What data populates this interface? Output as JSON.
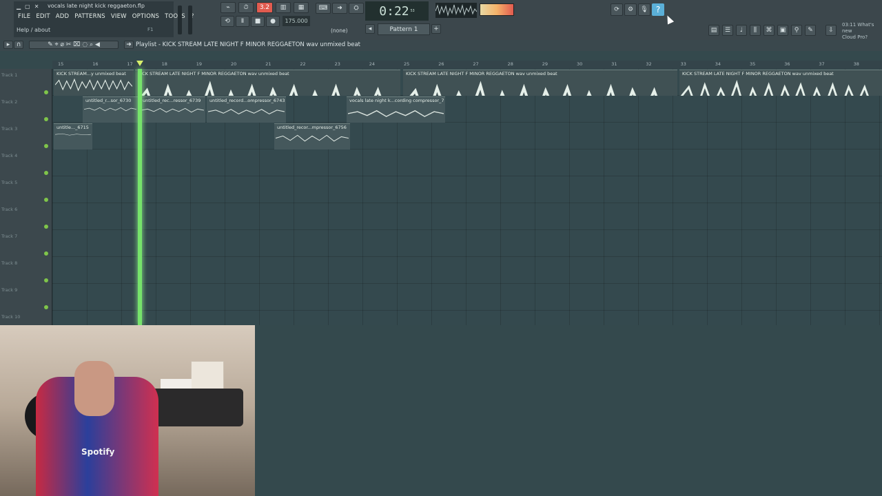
{
  "app": {
    "window_title": "vocals late night kick reggaeton.flp",
    "window_buttons": [
      "▁",
      "▢",
      "✕"
    ],
    "menu": [
      "FILE",
      "EDIT",
      "ADD",
      "PATTERNS",
      "VIEW",
      "OPTIONS",
      "TOOLS",
      "?"
    ],
    "hint_text": "Help / about",
    "hint_shortcut": "F1"
  },
  "transport": {
    "time": "0:22",
    "time_small": "53",
    "time_units": "M:S:CS",
    "tempo": "175.000",
    "step": "3.2",
    "none_label": "(none)",
    "pattern": "Pattern 1"
  },
  "playlist": {
    "title": "Playlist - KICK STREAM LATE NIGHT F MINOR REGGAETON wav unmixed beat",
    "ruler": [
      "15",
      "16",
      "17",
      "18",
      "19",
      "20",
      "21",
      "22",
      "23",
      "24",
      "25",
      "26",
      "27",
      "28",
      "29",
      "30",
      "31",
      "32",
      "33",
      "34",
      "35",
      "36",
      "37",
      "38"
    ],
    "tracks": [
      "Track 1",
      "Track 2",
      "Track 3",
      "Track 4",
      "Track 5",
      "Track 6",
      "Track 7",
      "Track 8",
      "Track 9",
      "Track 10"
    ],
    "clips": [
      {
        "label": "KICK STREAM...y unmixed beat",
        "track": 1
      },
      {
        "label": "KICK STREAM LATE NIGHT F MINOR REGGAETON wav unmixed beat",
        "track": 1
      },
      {
        "label": "KICK STREAM LATE NIGHT F MINOR REGGAETON wav unmixed beat",
        "track": 1
      },
      {
        "label": "KICK STREAM LATE NIGHT F MINOR REGGAETON wav unmixed beat",
        "track": 1
      },
      {
        "label": "untitled_r...sor_6730",
        "track": 2
      },
      {
        "label": "untitled_rec...ressor_6739",
        "track": 2
      },
      {
        "label": "untitled_record...ompressor_6743",
        "track": 2
      },
      {
        "label": "vocals late night k...cording compressor_7",
        "track": 2
      },
      {
        "label": "untitle..._6715",
        "track": 3
      },
      {
        "label": "untitled_recor...mpressor_6756",
        "track": 3
      }
    ]
  },
  "right_panel": {
    "news_date": "03:11",
    "news_title": "What's new",
    "news_subtitle": "Cloud Pro?"
  },
  "webcam": {
    "jersey_text": "Spotify"
  },
  "colors": {
    "background": "#34494d",
    "playhead": "#76e36b",
    "accent_red": "#e15b4f",
    "track_dot": "#7fc54a",
    "hint_blue": "#5bb0d8"
  }
}
